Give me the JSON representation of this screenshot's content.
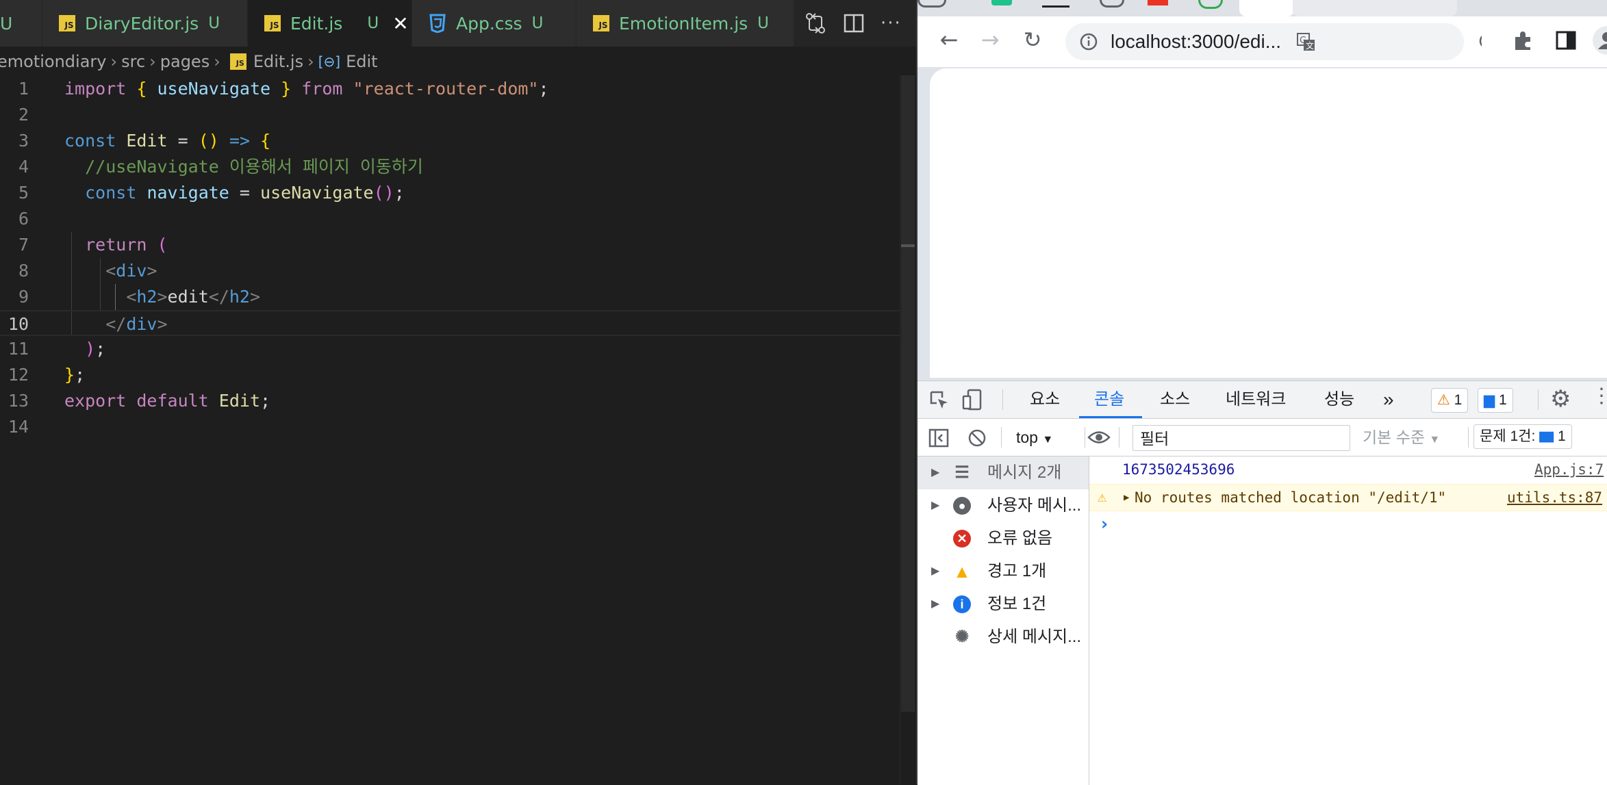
{
  "editor": {
    "tabs": [
      {
        "label": "DiaryEditor.js",
        "status": "U",
        "type": "js"
      },
      {
        "label": "Edit.js",
        "status": "U",
        "type": "js",
        "active": true
      },
      {
        "label": "App.css",
        "status": "U",
        "type": "css"
      },
      {
        "label": "EmotionItem.js",
        "status": "U",
        "type": "js"
      }
    ],
    "leading_status": "U",
    "breadcrumb": [
      "emotiondiary",
      "src",
      "pages",
      "Edit.js",
      "Edit"
    ],
    "code_lines": [
      "import { useNavigate } from \"react-router-dom\";",
      "",
      "const Edit = () => {",
      "  //useNavigate 이용해서 페이지 이동하기",
      "  const navigate = useNavigate();",
      "",
      "  return (",
      "    <div>",
      "      <h2>edit</h2>",
      "    </div>",
      "  );",
      "};",
      "export default Edit;",
      ""
    ],
    "line_numbers": [
      "1",
      "2",
      "3",
      "4",
      "5",
      "6",
      "7",
      "8",
      "9",
      "10",
      "11",
      "12",
      "13",
      "14"
    ],
    "current_line": 10
  },
  "browser": {
    "url": "localhost:3000/edi...",
    "devtools": {
      "tabs": [
        "요소",
        "콘솔",
        "소스",
        "네트워크",
        "성능",
        "»"
      ],
      "active_tab": "콘솔",
      "warning_count": "1",
      "info_count": "1",
      "context": "top",
      "filter_placeholder": "필터",
      "level": "기본 수준",
      "issues_label": "문제 1건:",
      "issues_count": "1",
      "sidebar": [
        {
          "label": "메시지 2개",
          "icon": "list-icon"
        },
        {
          "label": "사용자 메시...",
          "icon": "user-icon"
        },
        {
          "label": "오류 없음",
          "icon": "error-icon"
        },
        {
          "label": "경고 1개",
          "icon": "warning-icon"
        },
        {
          "label": "정보 1건",
          "icon": "info-icon"
        },
        {
          "label": "상세 메시지...",
          "icon": "bug-icon"
        }
      ],
      "messages": [
        {
          "text": "1673502453696",
          "source": "App.js:7",
          "level": "log"
        },
        {
          "text": "No routes matched location \"/edit/1\"",
          "source": "utils.ts:87",
          "level": "warning"
        }
      ],
      "prompt": "›"
    }
  },
  "colors": {
    "accent": "#1a73e8",
    "vscode_bg": "#1e1e1e",
    "untracked": "#73c991"
  }
}
